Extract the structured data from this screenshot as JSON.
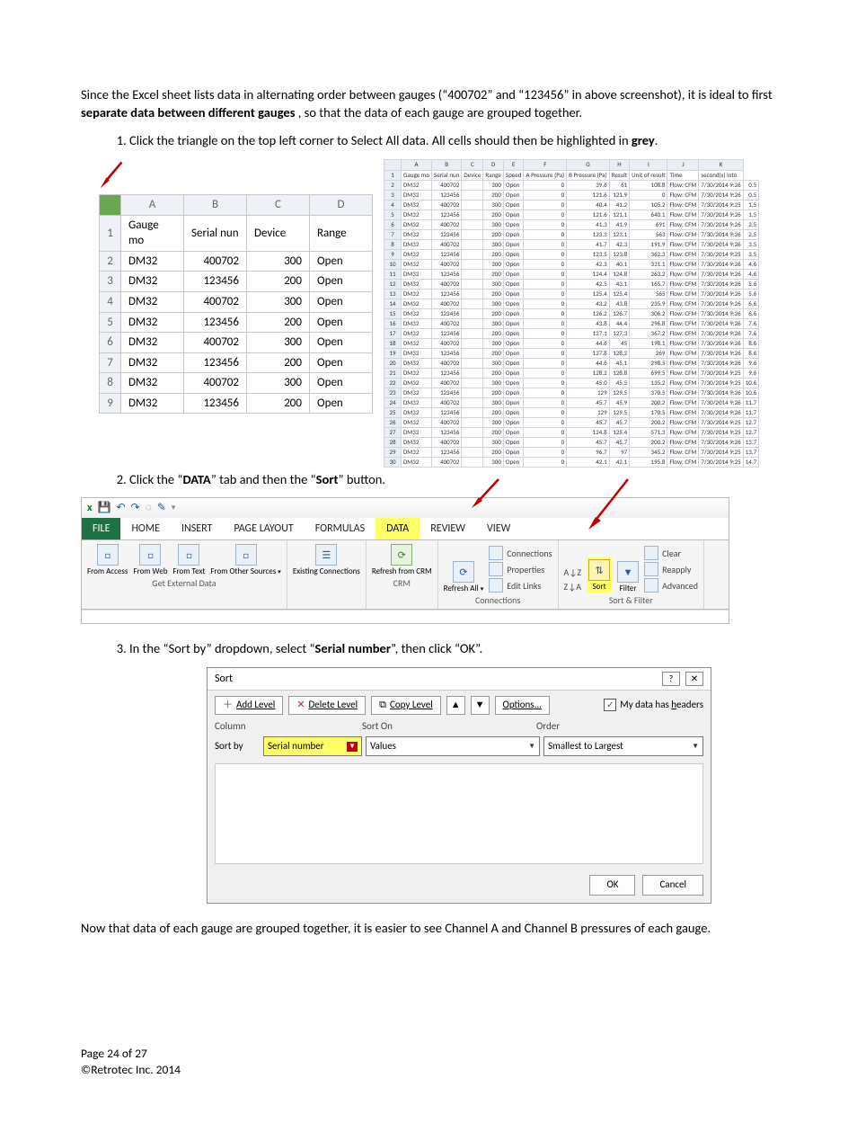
{
  "intro": "Since the Excel sheet lists data in alternating order between gauges (“400702” and “123456” in above screenshot), it is ideal to first ",
  "intro_bold": "separate data between different gauges",
  "intro_tail": ", so that the data of each gauge are grouped together.",
  "step1_a": "Click the triangle on the top left corner to Select All data. All cells should then be highlighted in ",
  "step1_b": "grey",
  "step1_c": ".",
  "mini_headers": [
    "A",
    "B",
    "C",
    "D"
  ],
  "mini_row1": [
    "Gauge mo",
    "Serial nun",
    "Device",
    "Range"
  ],
  "mini_rows": [
    [
      "DM32",
      "400702",
      "",
      "300",
      "Open"
    ],
    [
      "DM32",
      "123456",
      "",
      "200",
      "Open"
    ],
    [
      "DM32",
      "400702",
      "",
      "300",
      "Open"
    ],
    [
      "DM32",
      "123456",
      "",
      "200",
      "Open"
    ],
    [
      "DM32",
      "400702",
      "",
      "300",
      "Open"
    ],
    [
      "DM32",
      "123456",
      "",
      "200",
      "Open"
    ],
    [
      "DM32",
      "400702",
      "",
      "300",
      "Open"
    ],
    [
      "DM32",
      "123456",
      "",
      "200",
      "Open"
    ]
  ],
  "big_headers": [
    "A",
    "B",
    "C",
    "D",
    "E",
    "F",
    "G",
    "H",
    "I",
    "J",
    "K"
  ],
  "big_row1": [
    "Gauge mo",
    "Serial nun",
    "Device",
    "Range",
    "Speed",
    "A Pressure (Pa)",
    "B Pressure (Pa)",
    "Result",
    "Unit of result",
    "Time",
    "second(s) into"
  ],
  "big_rows": [
    [
      "DM32",
      "400702",
      "",
      "300",
      "Open",
      "0",
      "39.6",
      "61",
      "108.8",
      "Flow: CFM",
      "7/30/2014 9:26",
      "0.5"
    ],
    [
      "DM32",
      "123456",
      "",
      "200",
      "Open",
      "0",
      "121.6",
      "121.9",
      "0",
      "Flow: CFM",
      "7/30/2014 9:26",
      "0.5"
    ],
    [
      "DM32",
      "400702",
      "",
      "300",
      "Open",
      "0",
      "40.4",
      "41.2",
      "105.2",
      "Flow: CFM",
      "7/30/2014 9:25",
      "1.5"
    ],
    [
      "DM32",
      "123456",
      "",
      "200",
      "Open",
      "0",
      "121.6",
      "121.1",
      "640.1",
      "Flow: CFM",
      "7/30/2014 9:26",
      "1.5"
    ],
    [
      "DM32",
      "400702",
      "",
      "300",
      "Open",
      "0",
      "41.3",
      "41.9",
      "691",
      "Flow: CFM",
      "7/30/2014 9:26",
      "2.5"
    ],
    [
      "DM32",
      "123456",
      "",
      "200",
      "Open",
      "0",
      "123.3",
      "123.1",
      "563",
      "Flow: CFM",
      "7/30/2014 9:26",
      "2.5"
    ],
    [
      "DM32",
      "400702",
      "",
      "300",
      "Open",
      "0",
      "41.7",
      "42.3",
      "191.9",
      "Flow: CFM",
      "7/30/2014 9:26",
      "3.5"
    ],
    [
      "DM32",
      "123456",
      "",
      "200",
      "Open",
      "0",
      "123.5",
      "123.8",
      "362.3",
      "Flow: CFM",
      "7/30/2014 9:25",
      "3.5"
    ],
    [
      "DM32",
      "400702",
      "",
      "300",
      "Open",
      "0",
      "42.3",
      "40.1",
      "331.1",
      "Flow: CFM",
      "7/30/2014 9:26",
      "4.6"
    ],
    [
      "DM32",
      "123456",
      "",
      "200",
      "Open",
      "0",
      "124.4",
      "124.8",
      "263.2",
      "Flow: CFM",
      "7/30/2014 9:26",
      "4.6"
    ],
    [
      "DM32",
      "400702",
      "",
      "300",
      "Open",
      "0",
      "42.5",
      "43.1",
      "165.7",
      "Flow: CFM",
      "7/30/2014 9:26",
      "5.6"
    ],
    [
      "DM32",
      "123456",
      "",
      "200",
      "Open",
      "0",
      "125.4",
      "125.4",
      "565",
      "Flow: CFM",
      "7/30/2014 9:26",
      "5.6"
    ],
    [
      "DM32",
      "400702",
      "",
      "300",
      "Open",
      "0",
      "43.2",
      "43.8",
      "235.9",
      "Flow: CFM",
      "7/30/2014 9:26",
      "6.6"
    ],
    [
      "DM32",
      "123456",
      "",
      "200",
      "Open",
      "0",
      "126.2",
      "126.7",
      "306.2",
      "Flow: CFM",
      "7/30/2014 9:26",
      "6.6"
    ],
    [
      "DM32",
      "400702",
      "",
      "300",
      "Open",
      "0",
      "43.8",
      "44.4",
      "296.8",
      "Flow: CFM",
      "7/30/2014 9:26",
      "7.6"
    ],
    [
      "DM32",
      "123456",
      "",
      "200",
      "Open",
      "0",
      "127.1",
      "127.3",
      "367.2",
      "Flow: CFM",
      "7/30/2014 9:26",
      "7.6"
    ],
    [
      "DM32",
      "400702",
      "",
      "300",
      "Open",
      "0",
      "44.6",
      "45",
      "198.1",
      "Flow: CFM",
      "7/30/2014 9:26",
      "8.6"
    ],
    [
      "DM32",
      "123456",
      "",
      "200",
      "Open",
      "0",
      "127.8",
      "128.2",
      "269",
      "Flow: CFM",
      "7/30/2014 9:26",
      "8.6"
    ],
    [
      "DM32",
      "400702",
      "",
      "300",
      "Open",
      "0",
      "44.6",
      "45.1",
      "298.5",
      "Flow: CFM",
      "7/30/2014 9:26",
      "9.6"
    ],
    [
      "DM32",
      "123456",
      "",
      "200",
      "Open",
      "0",
      "128.2",
      "128.8",
      "699.5",
      "Flow: CFM",
      "7/30/2014 9:25",
      "9.6"
    ],
    [
      "DM32",
      "400702",
      "",
      "300",
      "Open",
      "0",
      "45.0",
      "45.5",
      "135.2",
      "Flow: CFM",
      "7/30/2014 9:25",
      "10.6"
    ],
    [
      "DM32",
      "123456",
      "",
      "200",
      "Open",
      "0",
      "129",
      "129.5",
      "370.5",
      "Flow: CFM",
      "7/30/2014 9:26",
      "10.6"
    ],
    [
      "DM32",
      "400702",
      "",
      "300",
      "Open",
      "0",
      "45.7",
      "45.9",
      "200.2",
      "Flow: CFM",
      "7/30/2014 9:26",
      "11.7"
    ],
    [
      "DM32",
      "123456",
      "",
      "200",
      "Open",
      "0",
      "129",
      "129.5",
      "170.5",
      "Flow: CFM",
      "7/30/2014 9:26",
      "11.7"
    ],
    [
      "DM32",
      "400702",
      "",
      "300",
      "Open",
      "0",
      "45.7",
      "45.7",
      "200.2",
      "Flow: CFM",
      "7/30/2014 9:25",
      "12.7"
    ],
    [
      "DM32",
      "123456",
      "",
      "200",
      "Open",
      "0",
      "124.8",
      "125.4",
      "571.3",
      "Flow: CFM",
      "7/30/2014 9:25",
      "12.7"
    ],
    [
      "DM32",
      "400702",
      "",
      "300",
      "Open",
      "0",
      "45.7",
      "45.7",
      "200.2",
      "Flow: CFM",
      "7/30/2014 9:26",
      "13.7"
    ],
    [
      "DM32",
      "123456",
      "",
      "200",
      "Open",
      "0",
      "96.7",
      "97",
      "345.2",
      "Flow: CFM",
      "7/30/2014 9:25",
      "13.7"
    ],
    [
      "DM32",
      "400702",
      "",
      "300",
      "Open",
      "0",
      "42.1",
      "42.1",
      "195.8",
      "Flow: CFM",
      "7/30/2014 9:25",
      "14.7"
    ]
  ],
  "step2_a": "Click the “",
  "step2_b": "DATA",
  "step2_c": "” tab and then the “",
  "step2_d": "Sort",
  "step2_e": "” button.",
  "ribbon": {
    "tabs": [
      "FILE",
      "HOME",
      "INSERT",
      "PAGE LAYOUT",
      "FORMULAS",
      "DATA",
      "REVIEW",
      "VIEW"
    ],
    "grp_ext": {
      "items": [
        "From Access",
        "From Web",
        "From Text",
        "From Other Sources"
      ],
      "title": "Get External Data",
      "extra": "Existing Connections"
    },
    "grp_crm": {
      "item": "Refresh from CRM",
      "title": "CRM"
    },
    "grp_conn": {
      "item": "Refresh All",
      "links": [
        "Connections",
        "Properties",
        "Edit Links"
      ],
      "title": "Connections"
    },
    "grp_sort": {
      "az": "A↓Z",
      "za": "Z↓A",
      "sort": "Sort",
      "filter": "Filter",
      "links": [
        "Clear",
        "Reapply",
        "Advanced"
      ],
      "title": "Sort & Filter"
    }
  },
  "step3_a": "In the “Sort by” dropdown, select “",
  "step3_b": "Serial number",
  "step3_c": "”, then click “OK”.",
  "dialog": {
    "title": "Sort",
    "add": "Add Level",
    "del": "Delete Level",
    "copy": "Copy Level",
    "opts": "Options...",
    "headers_chk": "My data has headers",
    "cols": [
      "Column",
      "Sort On",
      "Order"
    ],
    "sortby_label": "Sort by",
    "sortby_val": "Serial number",
    "sorton_val": "Values",
    "order_val": "Smallest to Largest",
    "ok": "OK",
    "cancel": "Cancel"
  },
  "outro": "Now that data of each gauge are grouped together, it is easier to see Channel A and Channel B pressures of each gauge.",
  "footer_page": "Page 24 of 27",
  "footer_copy": "©Retrotec Inc. 2014"
}
